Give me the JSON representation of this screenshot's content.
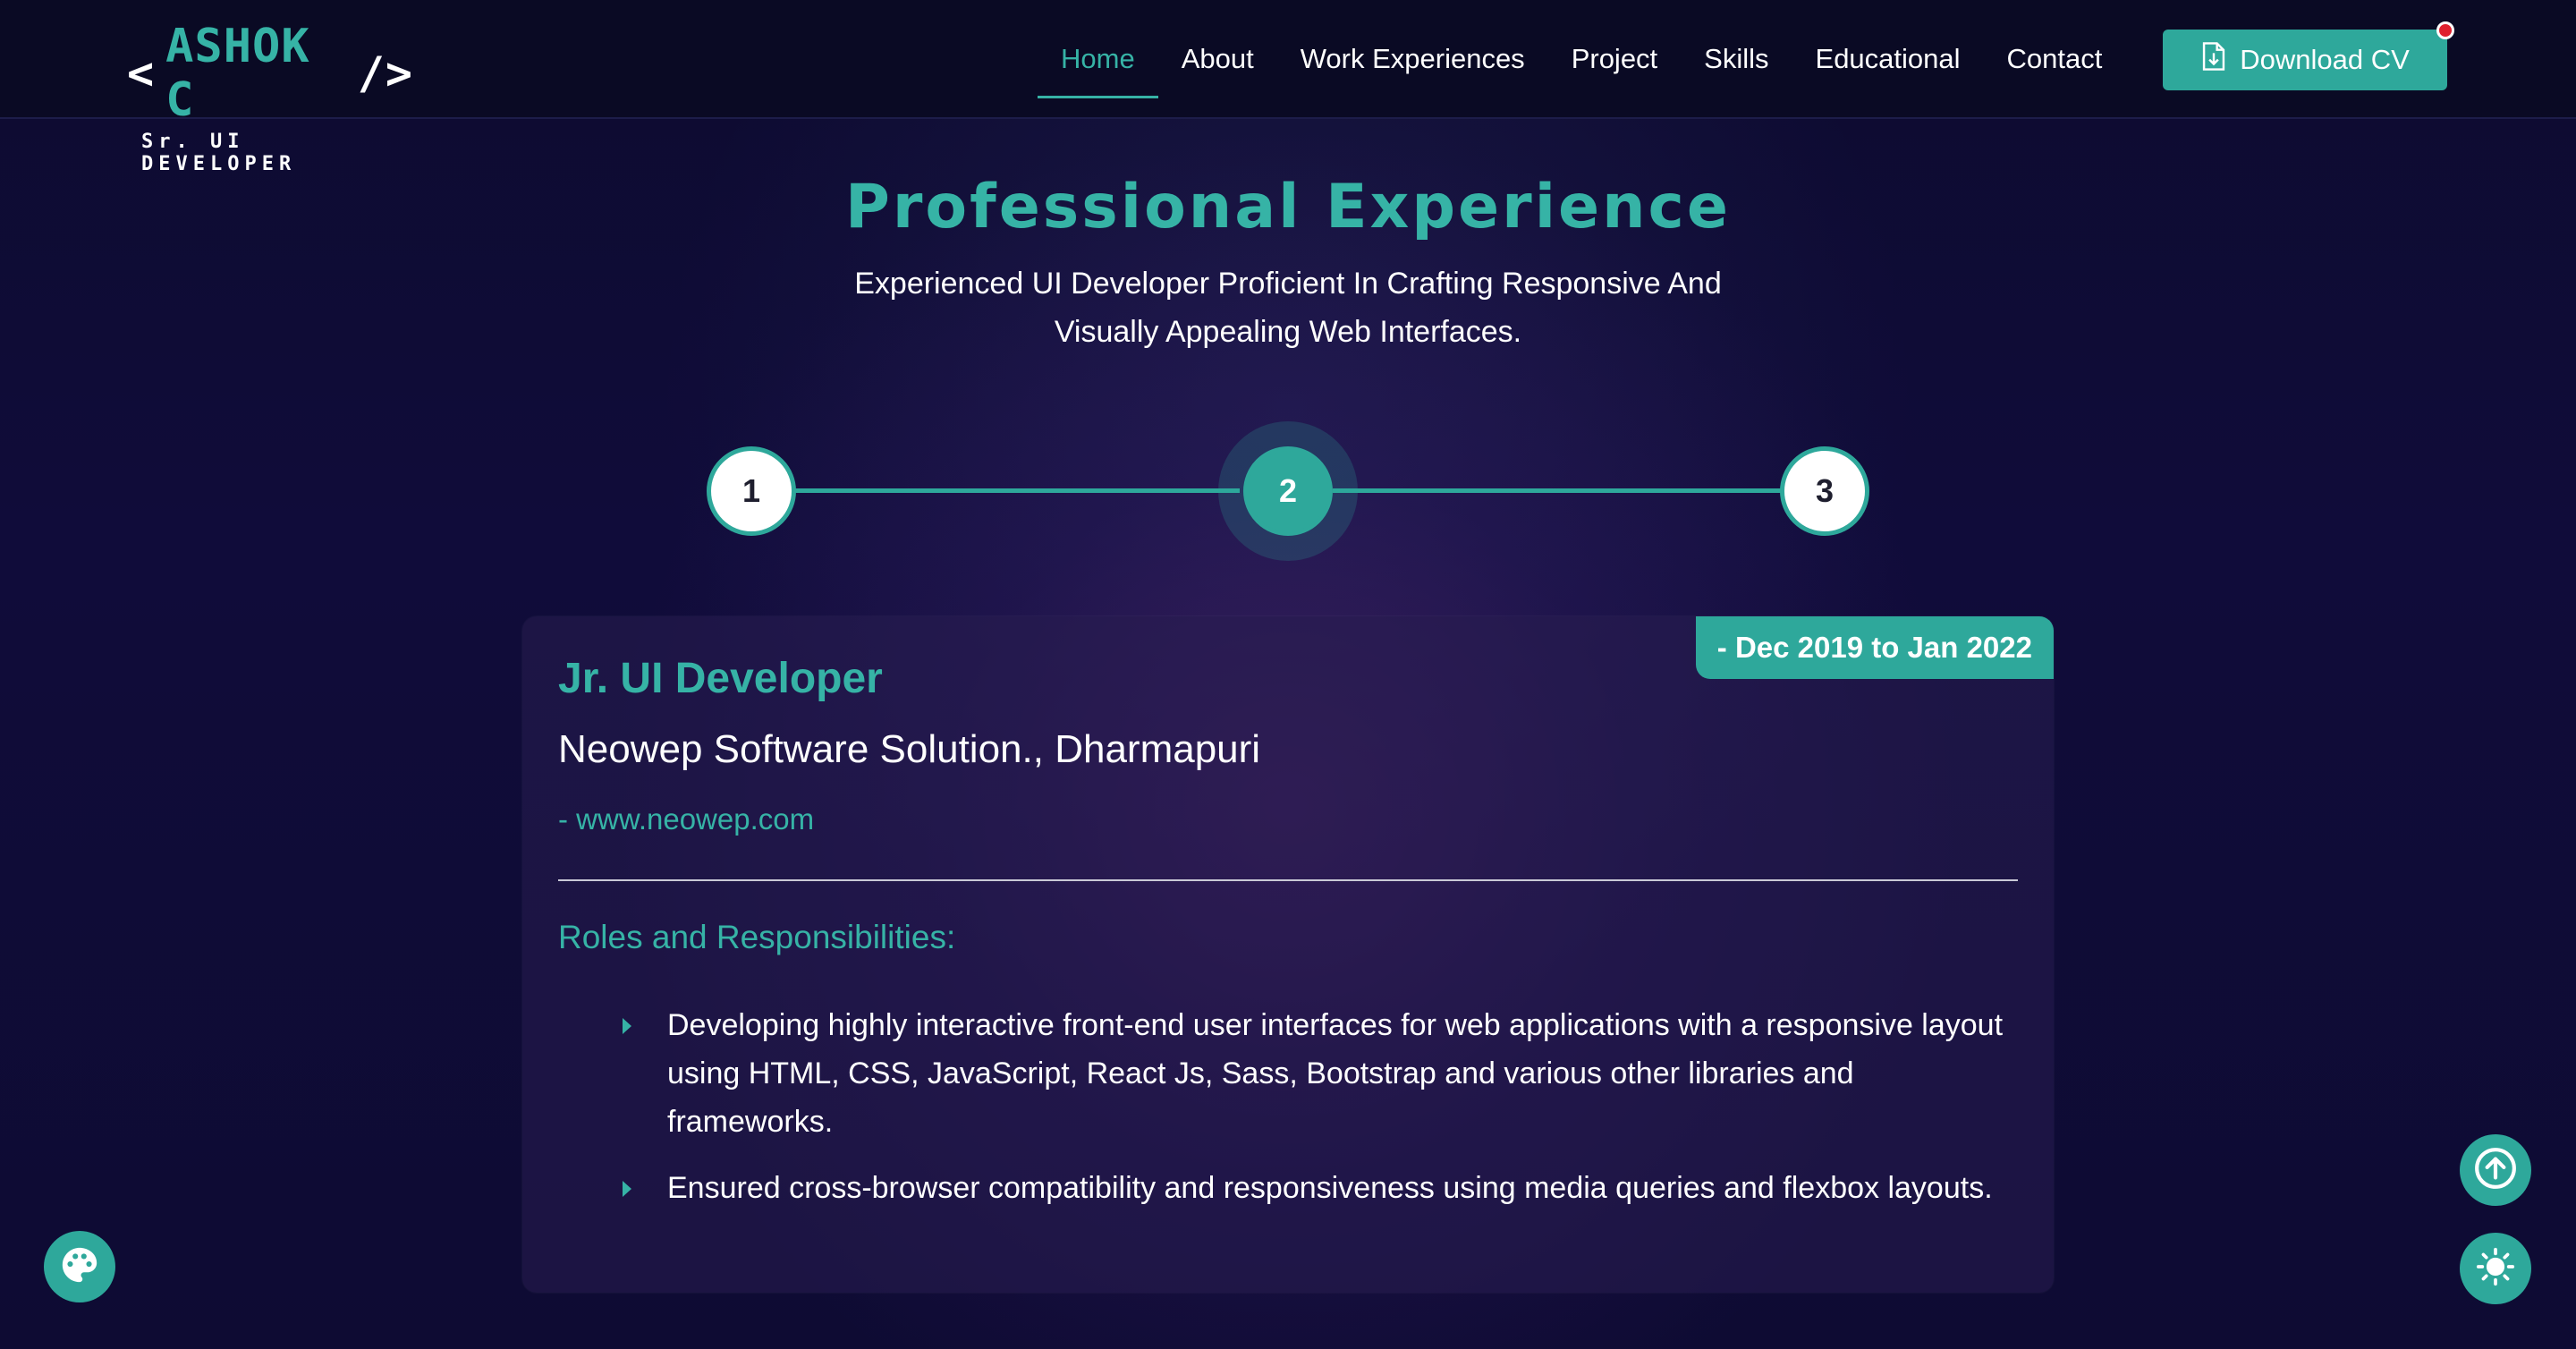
{
  "header": {
    "logo": {
      "name": "ASHOK C",
      "open_bracket": "<",
      "close_bracket": "/>",
      "subtitle": "Sr. UI DEVELOPER"
    },
    "nav": [
      {
        "label": "Home",
        "active": true
      },
      {
        "label": "About",
        "active": false
      },
      {
        "label": "Work Experiences",
        "active": false
      },
      {
        "label": "Project",
        "active": false
      },
      {
        "label": "Skills",
        "active": false
      },
      {
        "label": "Educational",
        "active": false
      },
      {
        "label": "Contact",
        "active": false
      }
    ],
    "download_cv_label": "Download CV"
  },
  "section": {
    "title": "Professional Experience",
    "subtitle": "Experienced UI Developer Proficient In Crafting Responsive And Visually Appealing Web Interfaces."
  },
  "stepper": {
    "steps": [
      "1",
      "2",
      "3"
    ],
    "active_step": "2"
  },
  "experience": {
    "date_range": "- Dec 2019 to Jan 2022",
    "job_title": "Jr. UI Developer",
    "company": "Neowep Software Solution., Dharmapuri",
    "website": "- www.neowep.com",
    "roles_heading": "Roles and Responsibilities:",
    "roles": [
      "Developing highly interactive front-end user interfaces for web applications with a responsive layout using HTML, CSS, JavaScript, React Js, Sass, Bootstrap and various other libraries and frameworks.",
      "Ensured cross-browser compatibility and responsiveness using media queries and flexbox layouts."
    ]
  },
  "floating_buttons": {
    "theme_palette_icon": "palette-icon",
    "scroll_top_icon": "arrow-up-circle-icon",
    "light_mode_icon": "sun-icon"
  },
  "colors": {
    "accent": "#2ea89b",
    "accent_text": "#36b3a6",
    "background": "#0c0a2c",
    "notification_dot": "#e0202e"
  }
}
